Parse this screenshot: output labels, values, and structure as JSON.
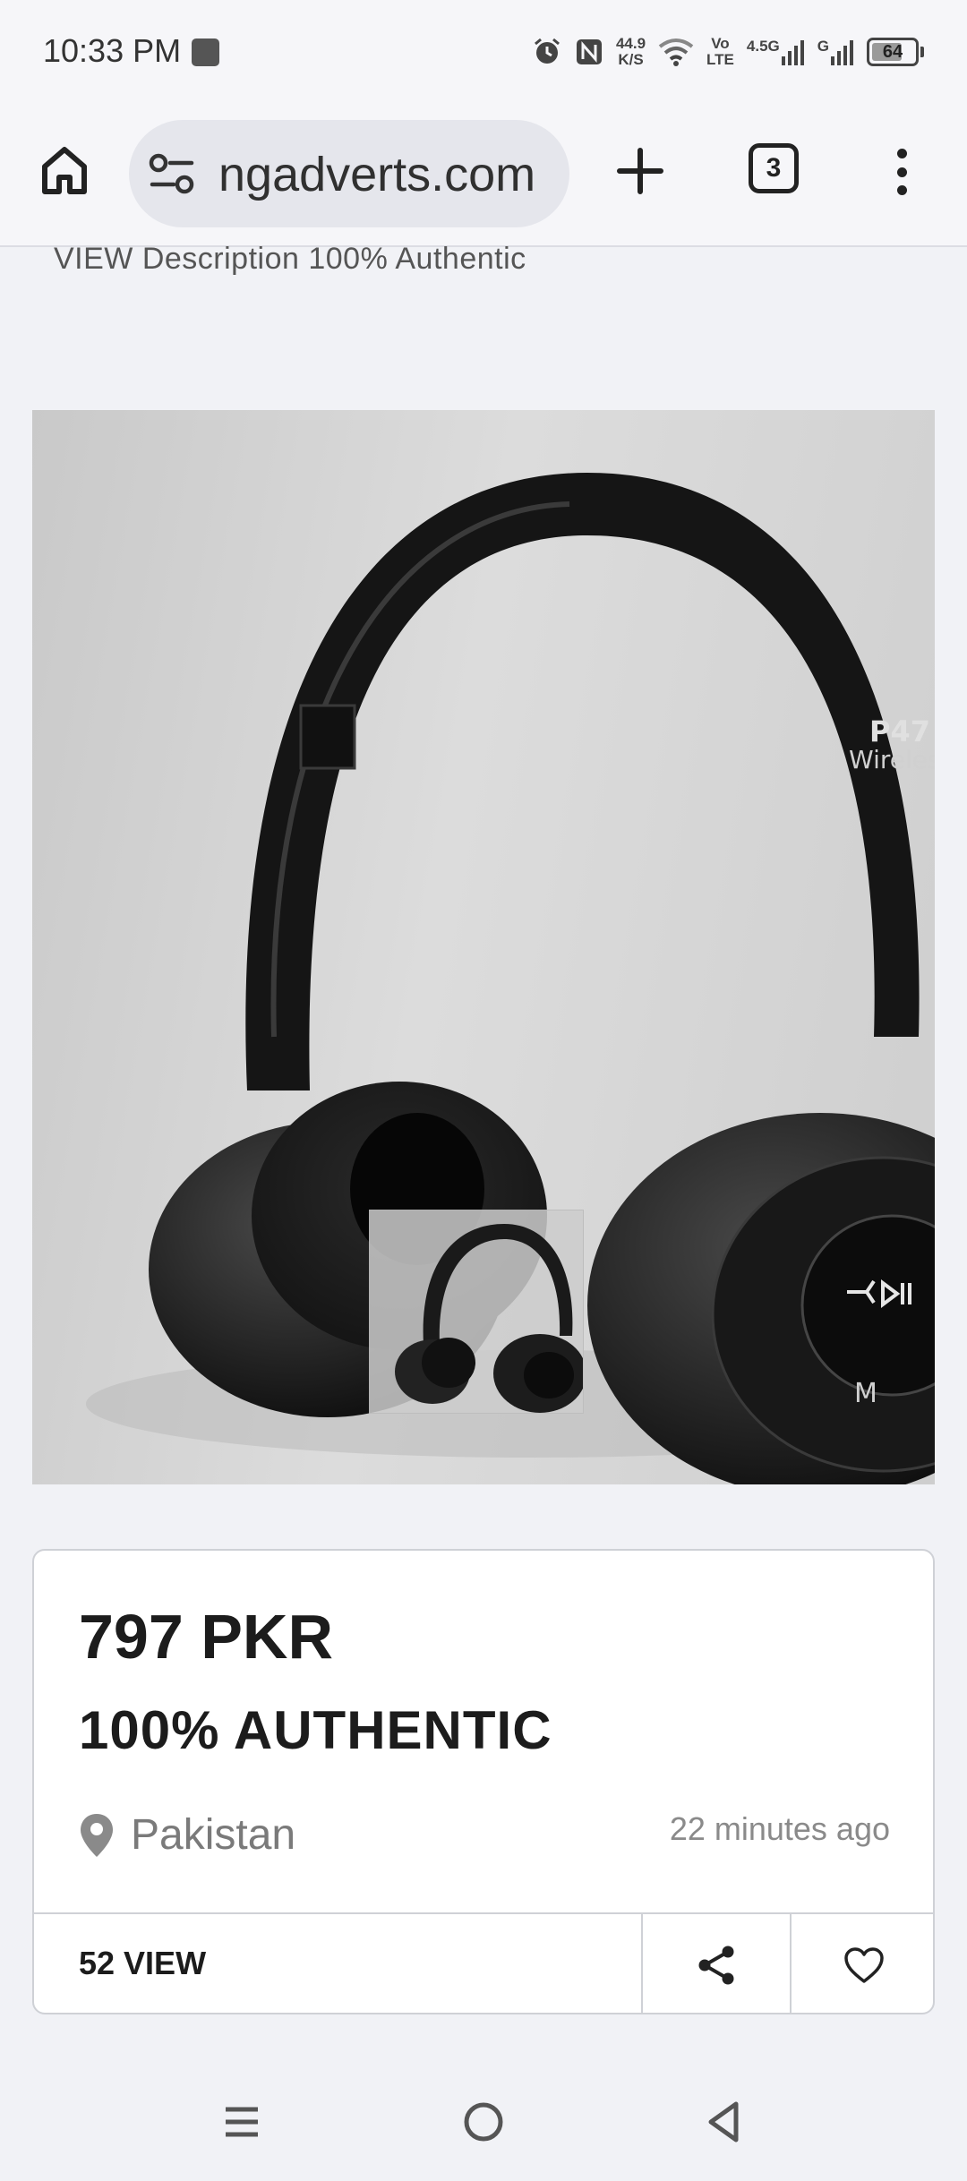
{
  "status_bar": {
    "time": "10:33 PM",
    "net_speed": "44.9",
    "net_unit": "K/S",
    "volte_top": "Vo",
    "volte_bottom": "LTE",
    "sig1_label": "4.5G",
    "sig2_label": "G",
    "battery": "64"
  },
  "browser": {
    "url": "ngadverts.com",
    "tab_count": "3",
    "icons": [
      "home-icon",
      "site-settings-icon",
      "new-tab-plus-icon",
      "tab-switcher-icon",
      "more-menu-icon"
    ]
  },
  "page": {
    "description_line": "VIEW Description 100% Authentic",
    "product_image": {
      "brand_model": "P47",
      "brand_sub": "Wireless",
      "button_label": "M"
    },
    "listing": {
      "price": "797 PKR",
      "title": "100% AUTHENTIC",
      "location": "Pakistan",
      "posted": "22 minutes ago",
      "views": "52 VIEW"
    }
  },
  "nav_bar": {
    "icons": [
      "recents-icon",
      "home-circle-icon",
      "back-icon"
    ]
  },
  "colors": {
    "background": "#f1f2f6",
    "card": "#ffffff",
    "text_dark": "#1c1c1c",
    "text_muted": "#7a7a7a"
  }
}
